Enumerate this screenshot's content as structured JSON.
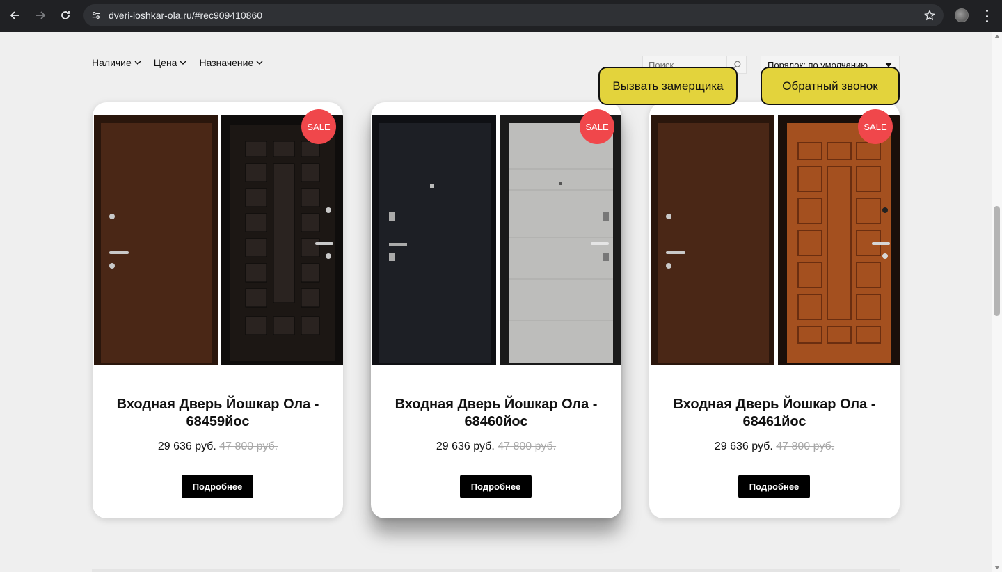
{
  "browser": {
    "url": "dveri-ioshkar-ola.ru/#rec909410860"
  },
  "filters": [
    {
      "label": "Наличие"
    },
    {
      "label": "Цена"
    },
    {
      "label": "Назначение"
    }
  ],
  "search": {
    "placeholder": "Поиск"
  },
  "sort": {
    "selected": "Порядок: по умолчанию"
  },
  "cta": {
    "measure_label": "Вызвать замерщика",
    "callback_label": "Обратный звонок"
  },
  "colors": {
    "cta_bg": "#e3d33c",
    "sale_badge": "#f0474b"
  },
  "products": [
    {
      "title": "Входная Дверь Йошкар Ола - 68459йос",
      "price": "29 636 руб.",
      "old_price": "47 800 руб.",
      "badge": "SALE",
      "button": "Подробнее",
      "outer_color": "#4a2716",
      "inner_color": "#1c1714",
      "inner_style": "dark-panels"
    },
    {
      "title": "Входная Дверь Йошкар Ола - 68460йос",
      "price": "29 636 руб.",
      "old_price": "47 800 руб.",
      "badge": "SALE",
      "button": "Подробнее",
      "outer_color": "#1d1f25",
      "inner_color": "#bdbdbb",
      "inner_style": "concrete"
    },
    {
      "title": "Входная Дверь Йошкар Ола - 68461йос",
      "price": "29 636 руб.",
      "old_price": "47 800 руб.",
      "badge": "SALE",
      "button": "Подробнее",
      "outer_color": "#4a2716",
      "inner_color": "#a4501f",
      "inner_style": "wood-panels"
    }
  ]
}
